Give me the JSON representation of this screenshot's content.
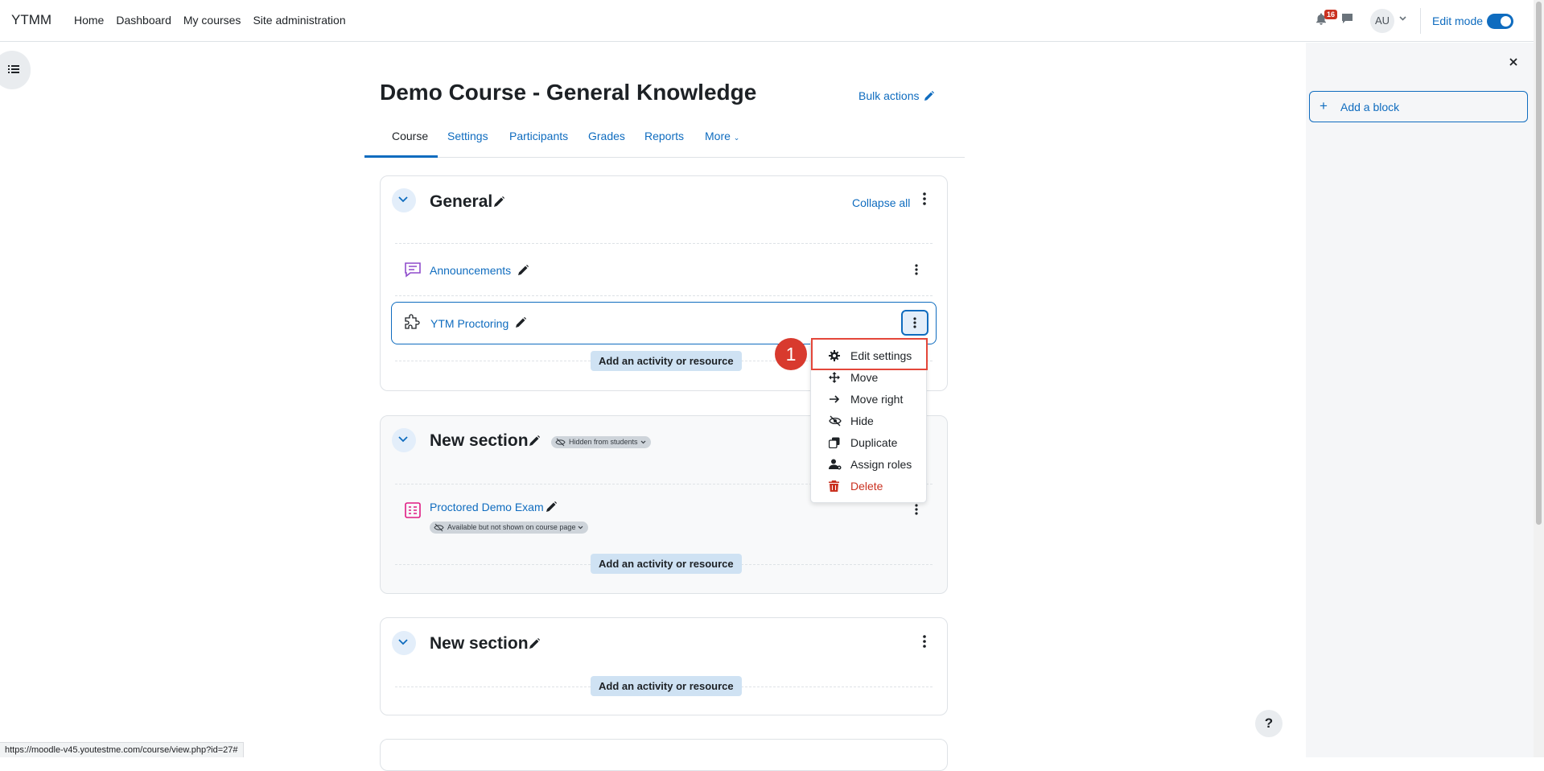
{
  "navbar": {
    "brand": "YTMM",
    "links": [
      "Home",
      "Dashboard",
      "My courses",
      "Site administration"
    ],
    "notification_count": "16",
    "avatar_initials": "AU",
    "edit_mode_label": "Edit mode",
    "edit_mode_on": true
  },
  "course": {
    "title": "Demo Course - General Knowledge",
    "bulk_actions": "Bulk actions",
    "tabs": [
      "Course",
      "Settings",
      "Participants",
      "Grades",
      "Reports",
      "More"
    ]
  },
  "sections": [
    {
      "title": "General",
      "collapse_all": "Collapse all",
      "activities": [
        {
          "name": "Announcements",
          "type": "forum-icon"
        },
        {
          "name": "YTM Proctoring",
          "type": "puzzle-icon"
        }
      ],
      "add_activity": "Add an activity or resource"
    },
    {
      "title": "New section",
      "visibility_badge": "Hidden from students",
      "activities": [
        {
          "name": "Proctored Demo Exam",
          "type": "quiz-icon",
          "availability": "Available but not shown on course page"
        }
      ],
      "add_activity": "Add an activity or resource"
    },
    {
      "title": "New section",
      "activities": [],
      "add_activity": "Add an activity or resource"
    }
  ],
  "action_menu": {
    "items": [
      {
        "label": "Edit settings",
        "icon": "gear-icon"
      },
      {
        "label": "Move",
        "icon": "move-icon"
      },
      {
        "label": "Move right",
        "icon": "arrow-right-icon"
      },
      {
        "label": "Hide",
        "icon": "eye-slash-icon"
      },
      {
        "label": "Duplicate",
        "icon": "copy-icon"
      },
      {
        "label": "Assign roles",
        "icon": "user-gear-icon"
      },
      {
        "label": "Delete",
        "icon": "trash-icon"
      }
    ]
  },
  "annotation": {
    "step": "1"
  },
  "drawer": {
    "add_block": "Add a block"
  },
  "help": "?",
  "status_url": "https://moodle-v45.youtestme.com/course/view.php?id=27#",
  "colors": {
    "link": "#0f6cbf",
    "danger": "#ca3120",
    "highlight": "#e4473a"
  }
}
